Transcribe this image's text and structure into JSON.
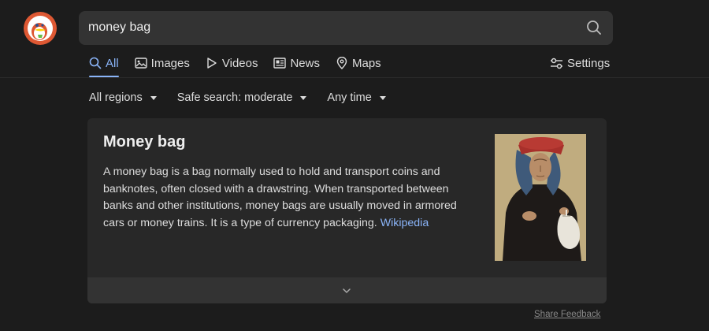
{
  "search": {
    "query": "money bag"
  },
  "tabs": [
    {
      "label": "All",
      "icon": "search-icon",
      "active": true
    },
    {
      "label": "Images",
      "icon": "image-icon",
      "active": false
    },
    {
      "label": "Videos",
      "icon": "play-icon",
      "active": false
    },
    {
      "label": "News",
      "icon": "newspaper-icon",
      "active": false
    },
    {
      "label": "Maps",
      "icon": "map-pin-icon",
      "active": false
    }
  ],
  "settings": {
    "label": "Settings",
    "icon": "sliders-icon"
  },
  "filters": [
    {
      "label": "All regions"
    },
    {
      "label": "Safe search: moderate"
    },
    {
      "label": "Any time"
    }
  ],
  "infobox": {
    "title": "Money bag",
    "description": "A money bag is a bag normally used to hold and transport coins and banknotes, often closed with a drawstring. When transported between banks and other institutions, money bags are usually moved in armored cars or money trains. It is a type of currency packaging.",
    "source_link": "Wikipedia",
    "expand_icon": "chevron-down-icon"
  },
  "footer": {
    "share_feedback": "Share Feedback"
  },
  "colors": {
    "background": "#1c1c1c",
    "search_box": "#333333",
    "card": "#282828",
    "accent": "#8ab4f8",
    "logo_orange": "#de5833"
  }
}
